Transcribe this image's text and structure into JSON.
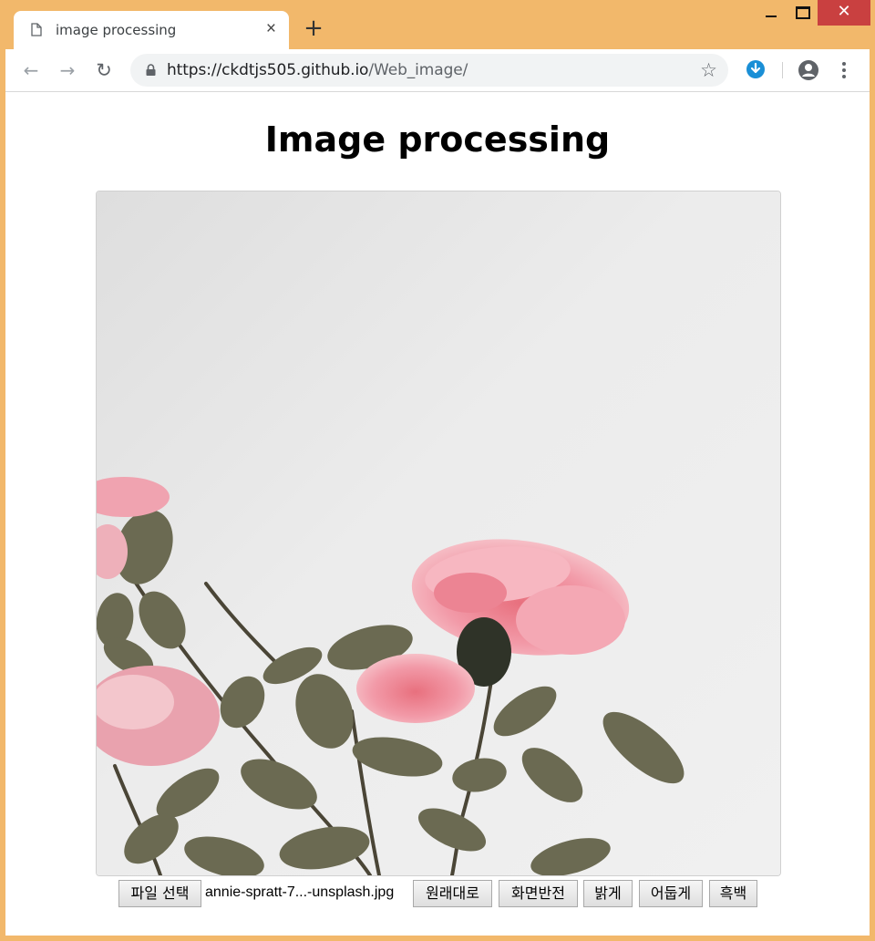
{
  "browser": {
    "tab_title": "image processing",
    "tab_close": "×",
    "new_tab": "+",
    "window_close": "✕",
    "url_domain": "https://ckdtjs505.github.io",
    "url_path": "/Web_image/",
    "star": "☆"
  },
  "page": {
    "heading": "Image processing",
    "file_button": "파일 선택",
    "file_name": "annie-spratt-7...-unsplash.jpg",
    "buttons": {
      "original": "원래대로",
      "invert": "화면반전",
      "bright": "밝게",
      "dark": "어둡게",
      "gray": "흑백"
    }
  },
  "colors": {
    "window_frame": "#f2b86b",
    "close_button": "#c94040",
    "rose": "#f29aa8",
    "leaf": "#6b6a52"
  }
}
